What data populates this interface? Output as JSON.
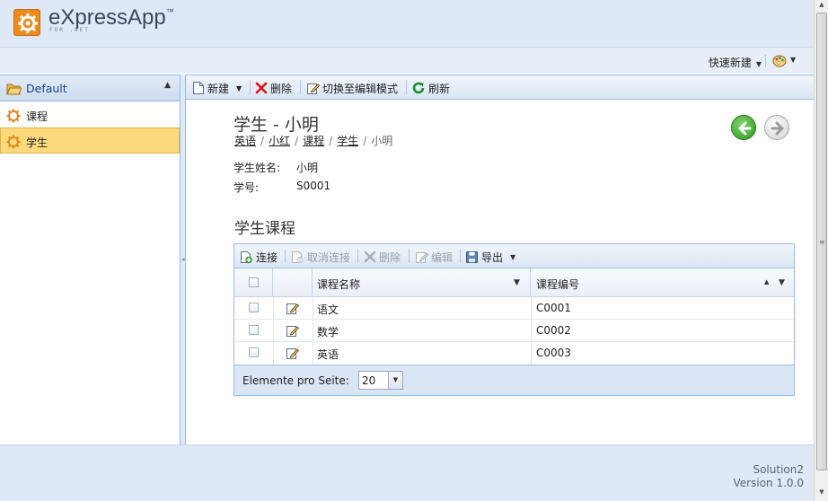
{
  "app": {
    "logo_text": "eXpressApp",
    "logo_tm": "™",
    "logo_sub": "FOR .NET"
  },
  "quickbar": {
    "quick_create_label": "快速新建"
  },
  "nav": {
    "group_title": "Default",
    "items": [
      {
        "label": "课程",
        "icon": "gear-icon",
        "selected": false
      },
      {
        "label": "学生",
        "icon": "gear-icon",
        "selected": true
      }
    ]
  },
  "toolbar": {
    "new_label": "新建",
    "delete_label": "删除",
    "edit_mode_label": "切换至编辑模式",
    "refresh_label": "刷新"
  },
  "detail": {
    "title": "学生 - 小明",
    "breadcrumb": [
      {
        "label": "英语",
        "link": true
      },
      {
        "label": "小红",
        "link": true
      },
      {
        "label": "课程",
        "link": true
      },
      {
        "label": "学生",
        "link": true
      },
      {
        "label": "小明",
        "link": false
      }
    ],
    "fields": [
      {
        "label": "学生姓名:",
        "value": "小明"
      },
      {
        "label": "学号:",
        "value": "S0001"
      }
    ],
    "section_title": "学生课程"
  },
  "grid": {
    "toolbar": {
      "link_label": "连接",
      "unlink_label": "取消连接",
      "delete_label": "删除",
      "edit_label": "编辑",
      "export_label": "导出"
    },
    "columns": [
      "课程名称",
      "课程编号"
    ],
    "rows": [
      {
        "name": "语文",
        "code": "C0001"
      },
      {
        "name": "数学",
        "code": "C0002"
      },
      {
        "name": "英语",
        "code": "C0003"
      }
    ],
    "pager_label": "Elemente pro Seite:",
    "page_size": "20"
  },
  "footer": {
    "solution_name": "Solution2",
    "version": "Version 1.0.0"
  },
  "colors": {
    "header_bg": "#dfe8f6",
    "selected_bg": "#fdd97e",
    "border": "#99bbe8",
    "logo_orange": "#ef8a1e",
    "back_green": "#2f9a22"
  }
}
